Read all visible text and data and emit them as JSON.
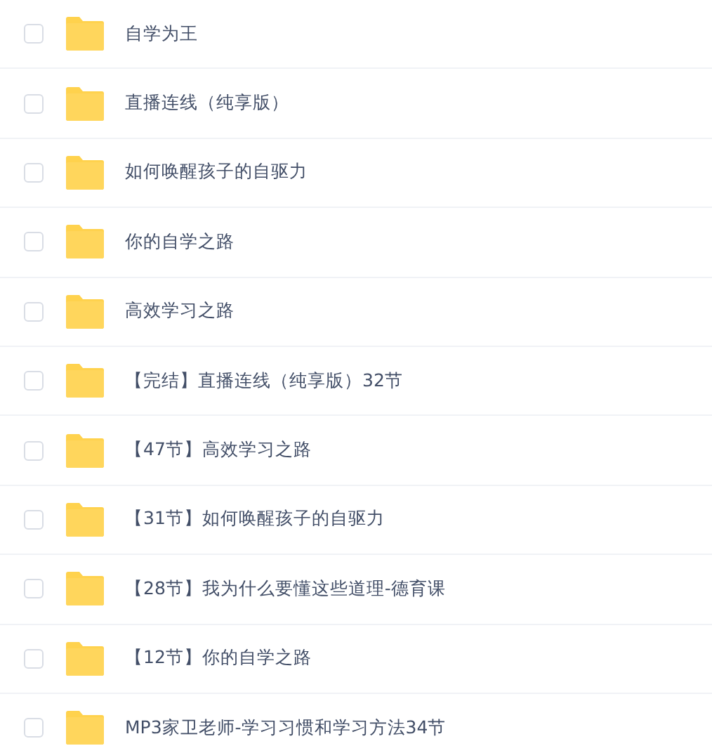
{
  "rows": [
    {
      "name": "自学为王",
      "checked": false
    },
    {
      "name": "直播连线（纯享版）",
      "checked": false
    },
    {
      "name": "如何唤醒孩子的自驱力",
      "checked": false
    },
    {
      "name": "你的自学之路",
      "checked": false
    },
    {
      "name": "高效学习之路",
      "checked": false
    },
    {
      "name": "【完结】直播连线（纯享版）32节",
      "checked": false
    },
    {
      "name": "【47节】高效学习之路",
      "checked": false
    },
    {
      "name": "【31节】如何唤醒孩子的自驱力",
      "checked": false
    },
    {
      "name": "【28节】我为什么要懂这些道理-德育课",
      "checked": false
    },
    {
      "name": "【12节】你的自学之路",
      "checked": false
    },
    {
      "name": "MP3家卫老师-学习习惯和学习方法34节",
      "checked": false
    }
  ]
}
